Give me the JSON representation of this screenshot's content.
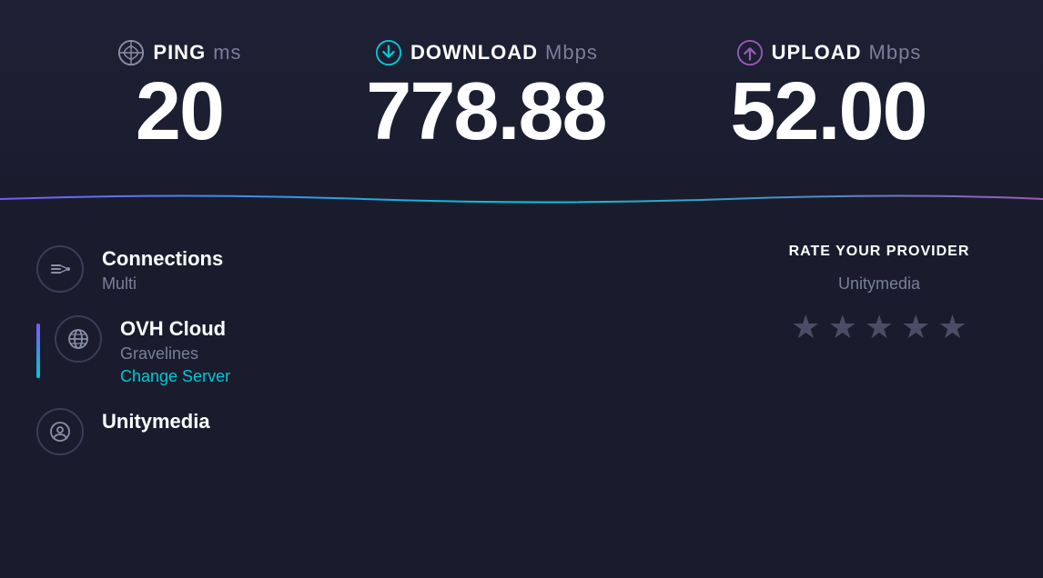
{
  "metrics": {
    "ping": {
      "label": "PING",
      "unit": "ms",
      "value": "20",
      "icon_name": "ping-icon"
    },
    "download": {
      "label": "DOWNLOAD",
      "unit": "Mbps",
      "value": "778.88",
      "icon_name": "download-icon"
    },
    "upload": {
      "label": "UPLOAD",
      "unit": "Mbps",
      "value": "52.00",
      "icon_name": "upload-icon"
    }
  },
  "connections": {
    "title": "Connections",
    "subtitle": "Multi"
  },
  "server": {
    "title": "OVH Cloud",
    "location": "Gravelines",
    "change_label": "Change Server"
  },
  "provider": {
    "title": "Unitymedia",
    "rate_label": "RATE YOUR PROVIDER",
    "provider_name": "Unitymedia",
    "stars": [
      "★",
      "★",
      "★",
      "★",
      "★"
    ]
  }
}
